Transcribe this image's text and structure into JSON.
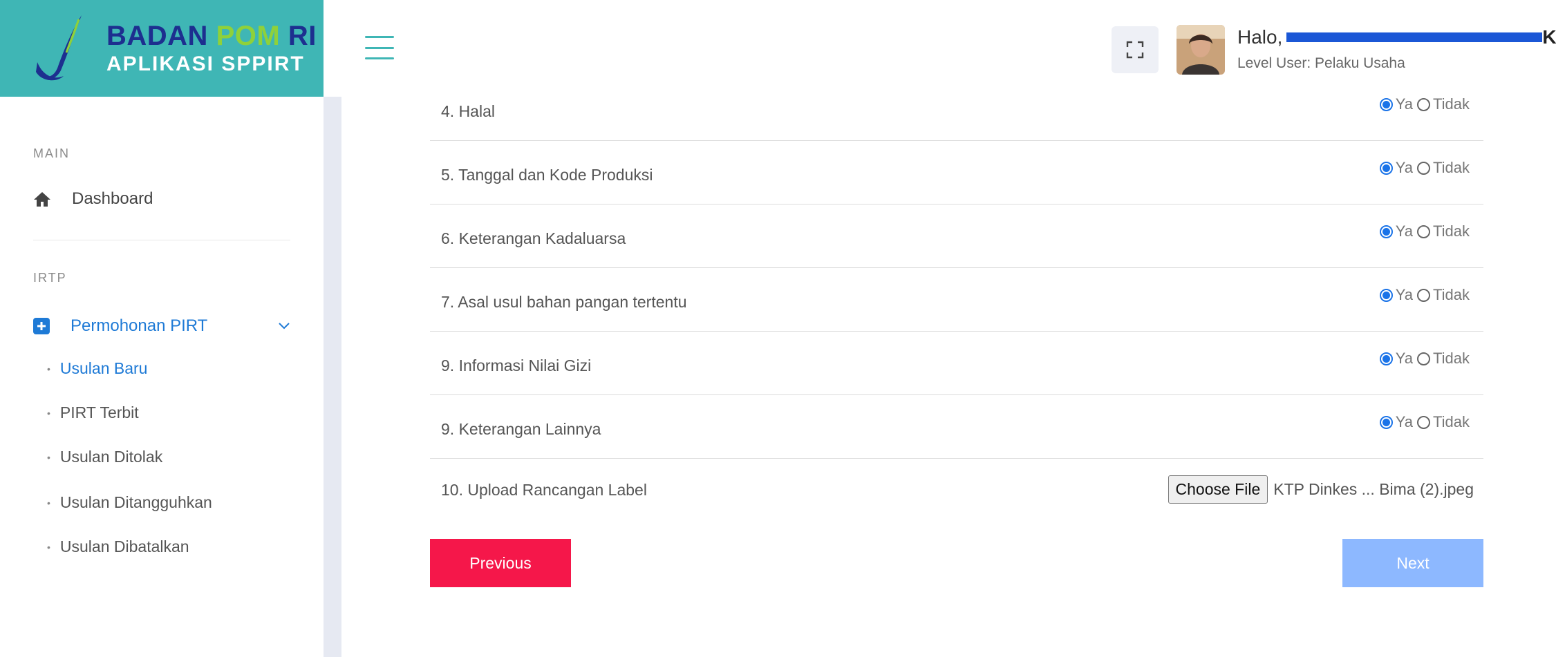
{
  "brand": {
    "line1_part1": "BADAN",
    "line1_part2": "POM",
    "line1_part3": "RI",
    "line2": "APLIKASI SPPIRT",
    "colors": {
      "bg": "#3fb6b5",
      "navy": "#1d2f8f",
      "green": "#8fd13a"
    }
  },
  "header": {
    "menu_icon": "hamburger-icon",
    "fullscreen_icon": "fullscreen-icon",
    "greeting": "Halo,",
    "user_name_tail": "K",
    "level_user": "Level User: Pelaku Usaha"
  },
  "sidebar": {
    "main_section": "MAIN",
    "dashboard_label": "Dashboard",
    "irtp_section": "IRTP",
    "permohonan_label": "Permohonan PIRT",
    "sub_items": [
      {
        "label": "Usulan Baru",
        "active": true
      },
      {
        "label": "PIRT Terbit",
        "active": false
      },
      {
        "label": "Usulan Ditolak",
        "active": false
      },
      {
        "label": "Usulan Ditangguhkan",
        "active": false
      },
      {
        "label": "Usulan Dibatalkan",
        "active": false
      }
    ]
  },
  "form": {
    "yes_label": "Ya",
    "no_label": "Tidak",
    "rows": [
      {
        "label": "4. Halal",
        "selected": "Ya"
      },
      {
        "label": "5. Tanggal dan Kode Produksi",
        "selected": "Ya"
      },
      {
        "label": "6. Keterangan Kadaluarsa",
        "selected": "Ya"
      },
      {
        "label": "7. Asal usul bahan pangan tertentu",
        "selected": "Ya"
      },
      {
        "label": "9. Informasi Nilai Gizi",
        "selected": "Ya"
      },
      {
        "label": "9. Keterangan Lainnya",
        "selected": "Ya"
      }
    ],
    "upload": {
      "label": "10. Upload Rancangan Label",
      "button": "Choose File",
      "filename": "KTP Dinkes ... Bima (2).jpeg"
    },
    "previous_label": "Previous",
    "next_label": "Next"
  }
}
